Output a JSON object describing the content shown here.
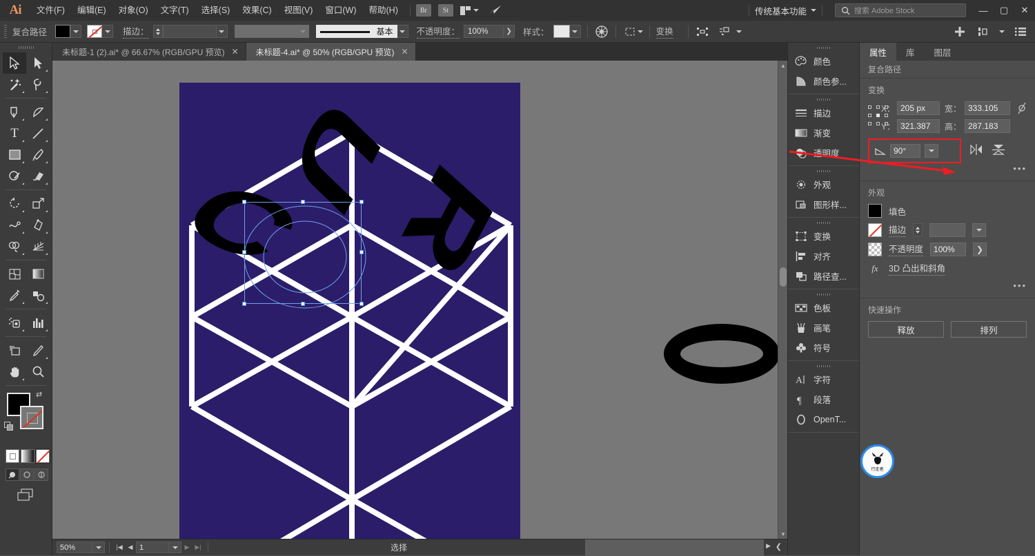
{
  "app": {
    "logo": "Ai",
    "workspace": "传统基本功能",
    "stock_search_placeholder": "搜索 Adobe Stock",
    "search_label": "搜索",
    "search_keyword": "Adobe Stock"
  },
  "menu": {
    "items": [
      "文件(F)",
      "编辑(E)",
      "对象(O)",
      "文字(T)",
      "选择(S)",
      "效果(C)",
      "视图(V)",
      "窗口(W)",
      "帮助(H)"
    ],
    "bridge": "Br",
    "stock": "St",
    "arrange_label": "arrange-documents",
    "sync_label": "sync-settings"
  },
  "window_controls": {
    "minimize": "—",
    "maximize": "▢",
    "close": "✕"
  },
  "control_bar": {
    "selection_type": "复合路径",
    "fill_color": "#000000",
    "stroke_color": "none",
    "stroke_label": "描边：",
    "stroke_weight": "",
    "stroke_profile": "",
    "brush_name": "基本",
    "opacity_label": "不透明度：",
    "opacity_value": "100%",
    "style_label": "样式：",
    "transform_label": "变换",
    "select_similar_tooltip": "选择类似对象",
    "align_tooltip": "对齐"
  },
  "tabs": [
    {
      "title": "未标题-1 (2).ai* @ 66.67% (RGB/GPU 预览)",
      "active": false,
      "close": "✕"
    },
    {
      "title": "未标题-4.ai* @ 50% (RGB/GPU 预览)",
      "active": true,
      "close": "✕"
    }
  ],
  "toolbar": {
    "tools": [
      {
        "name": "selection-tool",
        "glyph": "selection",
        "selected": true
      },
      {
        "name": "direct-selection-tool",
        "glyph": "direct-selection",
        "selected": false
      },
      {
        "name": "magic-wand-tool",
        "glyph": "magic-wand",
        "selected": false
      },
      {
        "name": "lasso-tool",
        "glyph": "lasso",
        "selected": false
      },
      {
        "name": "pen-tool",
        "glyph": "pen",
        "selected": false
      },
      {
        "name": "curvature-tool",
        "glyph": "curvature",
        "selected": false
      },
      {
        "name": "type-tool",
        "glyph": "T",
        "selected": false
      },
      {
        "name": "line-segment-tool",
        "glyph": "line",
        "selected": false
      },
      {
        "name": "rectangle-tool",
        "glyph": "rectangle",
        "selected": false
      },
      {
        "name": "paintbrush-tool",
        "glyph": "paintbrush",
        "selected": false
      },
      {
        "name": "shaper-tool",
        "glyph": "shaper",
        "selected": false
      },
      {
        "name": "eraser-tool",
        "glyph": "eraser",
        "selected": false
      },
      {
        "name": "rotate-tool",
        "glyph": "rotate",
        "selected": false
      },
      {
        "name": "scale-tool",
        "glyph": "scale",
        "selected": false
      },
      {
        "name": "width-tool",
        "glyph": "width",
        "selected": false
      },
      {
        "name": "free-transform-tool",
        "glyph": "free-transform",
        "selected": false
      },
      {
        "name": "shape-builder-tool",
        "glyph": "shape-builder",
        "selected": false
      },
      {
        "name": "perspective-grid-tool",
        "glyph": "perspective",
        "selected": false
      },
      {
        "name": "mesh-tool",
        "glyph": "mesh",
        "selected": false
      },
      {
        "name": "gradient-tool",
        "glyph": "gradient",
        "selected": false
      },
      {
        "name": "eyedropper-tool",
        "glyph": "eyedropper",
        "selected": false
      },
      {
        "name": "blend-tool",
        "glyph": "blend",
        "selected": false
      },
      {
        "name": "symbol-sprayer-tool",
        "glyph": "symbol-sprayer",
        "selected": false
      },
      {
        "name": "column-graph-tool",
        "glyph": "column-graph",
        "selected": false
      },
      {
        "name": "artboard-tool",
        "glyph": "artboard",
        "selected": false
      },
      {
        "name": "slice-tool",
        "glyph": "slice",
        "selected": false
      },
      {
        "name": "hand-tool",
        "glyph": "hand",
        "selected": false
      },
      {
        "name": "zoom-tool",
        "glyph": "zoom",
        "selected": false
      }
    ],
    "fill_swatch": "#000000",
    "stroke_swatch": "none",
    "color_mode_buttons": [
      "color",
      "gradient",
      "none"
    ],
    "draw_modes": [
      "draw-normal",
      "draw-behind",
      "draw-inside"
    ],
    "screen_mode": "change-screen-mode"
  },
  "canvas": {
    "background": "#787878",
    "artboard_fill": "#2b1d69",
    "line_color": "#ffffff",
    "letters": [
      {
        "char": "C",
        "name": "letter-c"
      },
      {
        "char": "U",
        "name": "letter-u"
      },
      {
        "char": "R",
        "name": "letter-r"
      }
    ],
    "loose_ellipse": "letter-o-outline",
    "selection_color": "#6ea2f0"
  },
  "status_bar": {
    "zoom": "50%",
    "page": "1",
    "status_text": "选择"
  },
  "dock": [
    {
      "label": "颜色",
      "icon": "palette-icon",
      "name": "dock-color"
    },
    {
      "label": "颜色参...",
      "icon": "color-guide-icon",
      "name": "dock-color-guide"
    },
    {
      "label": "描边",
      "icon": "stroke-icon",
      "name": "dock-stroke"
    },
    {
      "label": "渐变",
      "icon": "gradient-icon",
      "name": "dock-gradient"
    },
    {
      "label": "透明度",
      "icon": "transparency-icon",
      "name": "dock-transparency"
    },
    {
      "label": "外观",
      "icon": "appearance-icon",
      "name": "dock-appearance"
    },
    {
      "label": "图形样...",
      "icon": "graphic-styles-icon",
      "name": "dock-graphic-styles"
    },
    {
      "label": "变换",
      "icon": "transform-icon",
      "name": "dock-transform"
    },
    {
      "label": "对齐",
      "icon": "align-icon",
      "name": "dock-align"
    },
    {
      "label": "路径查...",
      "icon": "pathfinder-icon",
      "name": "dock-pathfinder"
    },
    {
      "label": "色板",
      "icon": "swatches-icon",
      "name": "dock-swatches"
    },
    {
      "label": "画笔",
      "icon": "brushes-icon",
      "name": "dock-brushes"
    },
    {
      "label": "符号",
      "icon": "symbols-icon",
      "name": "dock-symbols"
    },
    {
      "label": "字符",
      "icon": "character-icon",
      "name": "dock-character"
    },
    {
      "label": "段落",
      "icon": "paragraph-icon",
      "name": "dock-paragraph"
    },
    {
      "label": "OpenT...",
      "icon": "opentype-icon",
      "name": "dock-opentype"
    }
  ],
  "properties": {
    "tabs": [
      "属性",
      "库",
      "图层"
    ],
    "active_tab": "属性",
    "object_type": "复合路径",
    "transform": {
      "title": "变换",
      "x_label": "X：",
      "x_value": "205 px",
      "y_label": "Y：",
      "y_value": "321.387",
      "w_label": "宽：",
      "w_value": "333.105",
      "h_label": "高：",
      "h_value": "287.183",
      "angle_value": "90°",
      "highlight_color": "#ee1d23",
      "more_options": "•••"
    },
    "appearance": {
      "title": "外观",
      "fill_label": "填色",
      "fill_color": "#000000",
      "stroke_label": "描边",
      "stroke_value": "",
      "opacity_label": "不透明度",
      "opacity_value": "100%",
      "effect_label": "3D 凸出和斜角",
      "effect_prefix": "fx",
      "more_options": "•••"
    },
    "quick_actions": {
      "title": "快速操作",
      "buttons": [
        "释放",
        "排列"
      ]
    }
  },
  "watermark": {
    "text": "行走者",
    "ring_color": "#2a8aee"
  }
}
